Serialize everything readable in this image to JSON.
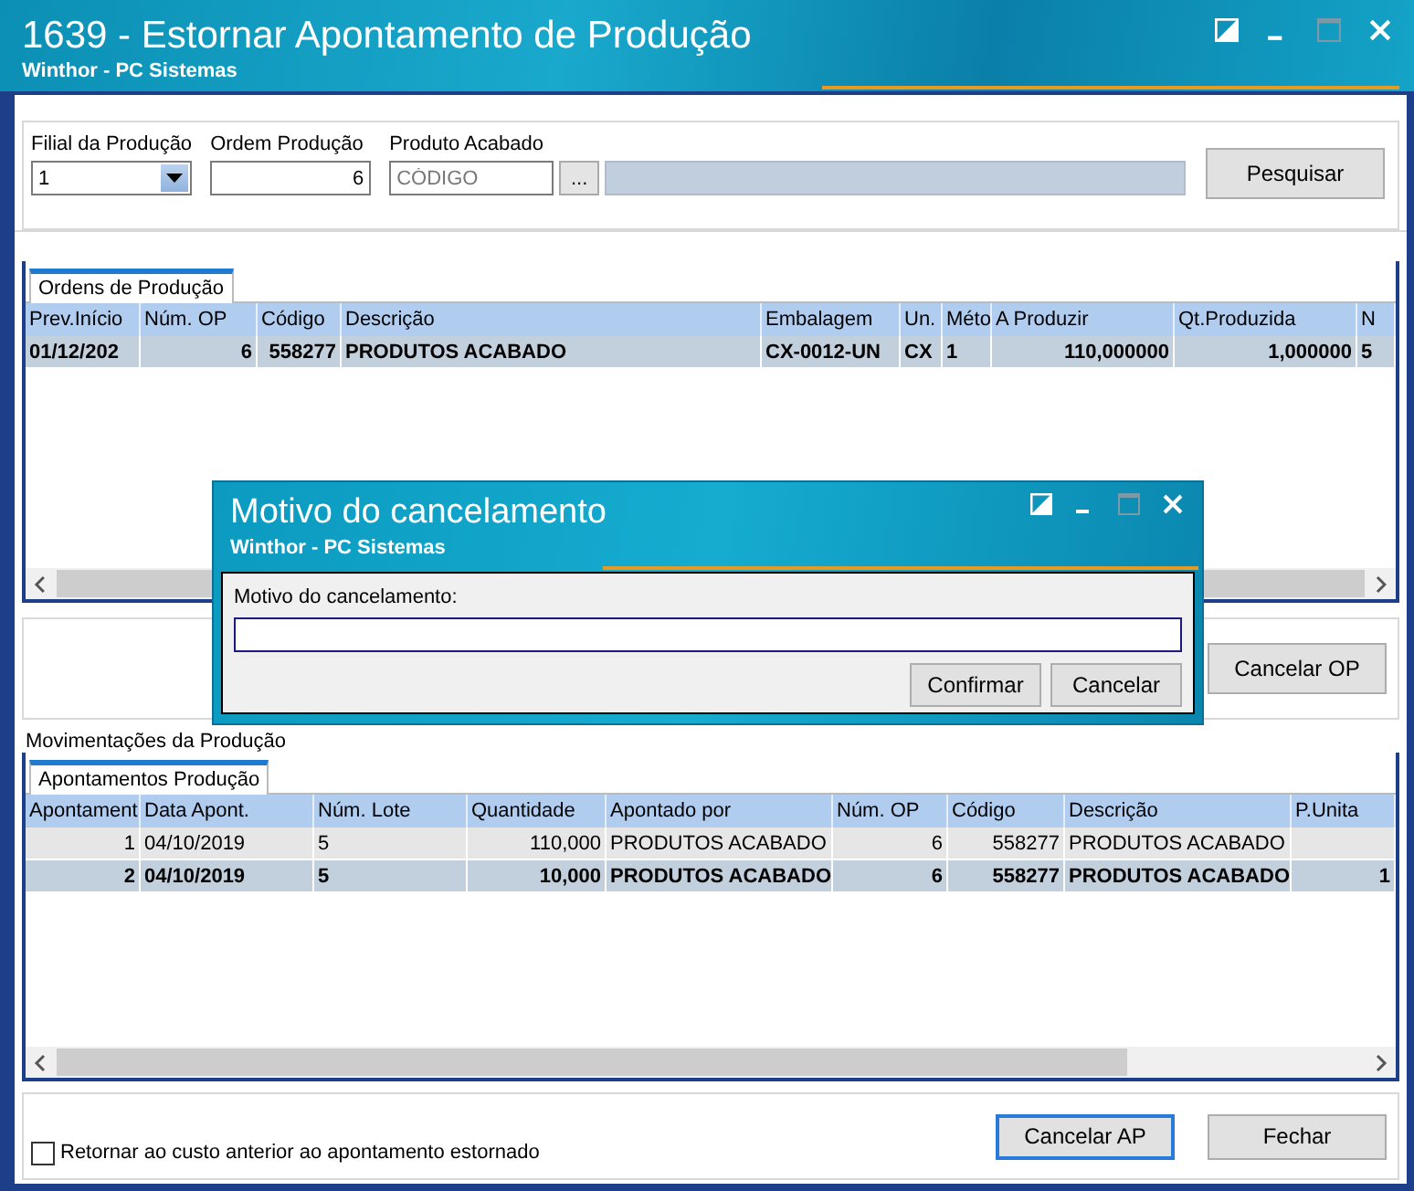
{
  "window": {
    "title": "1639 - Estornar Apontamento de Produção",
    "subtitle": "Winthor - PC Sistemas"
  },
  "filters": {
    "filial": {
      "label": "Filial da Produção",
      "value": "1"
    },
    "ordem": {
      "label": "Ordem Produção",
      "value": "6"
    },
    "produto": {
      "label": "Produto Acabado",
      "placeholder": "CÓDIGO",
      "browse": "..."
    },
    "search_button": "Pesquisar"
  },
  "orders": {
    "tabs": [
      {
        "label": "Ordens de Produção",
        "selected": true
      }
    ],
    "columns": [
      "Prev.Início",
      "Núm. OP",
      "Código",
      "Descrição",
      "Embalagem",
      "Un.",
      "Méto",
      "A Produzir",
      "Qt.Produzida",
      "N"
    ],
    "rows": [
      {
        "selected": true,
        "cells": [
          "01/12/202",
          "6",
          "558277",
          "PRODUTOS ACABADO",
          "CX-0012-UN",
          "CX",
          "1",
          "110,000000",
          "1,000000",
          "5"
        ]
      }
    ]
  },
  "cancel_op_button": "Cancelar OP",
  "movements": {
    "group_label": "Movimentações da Produção",
    "tabs": [
      {
        "label": "Apontamentos Produção",
        "selected": true
      }
    ],
    "columns": [
      "Apontament",
      "Data Apont.",
      "Núm. Lote",
      "Quantidade",
      "Apontado por",
      "Núm. OP",
      "Código",
      "Descrição",
      "P.Unita"
    ],
    "rows": [
      {
        "selected": false,
        "cells": [
          "1",
          "04/10/2019",
          "5",
          "110,000",
          "PRODUTOS ACABADO",
          "6",
          "558277",
          "PRODUTOS ACABADO",
          ""
        ]
      },
      {
        "selected": true,
        "cells": [
          "2",
          "04/10/2019",
          "5",
          "10,000",
          "PRODUTOS ACABADO",
          "6",
          "558277",
          "PRODUTOS ACABADO",
          "1"
        ]
      }
    ]
  },
  "return_cost": {
    "label": "Retornar ao custo anterior ao apontamento estornado",
    "checked": false
  },
  "buttons": [
    {
      "label": "Cancelar AP",
      "focused": true
    },
    {
      "label": "Fechar",
      "focused": false
    }
  ],
  "dialog": {
    "title": "Motivo do cancelamento",
    "subtitle": "Winthor - PC Sistemas",
    "field_label": "Motivo do cancelamento:",
    "buttons": [
      {
        "label": "Confirmar"
      },
      {
        "label": "Cancelar"
      }
    ]
  }
}
